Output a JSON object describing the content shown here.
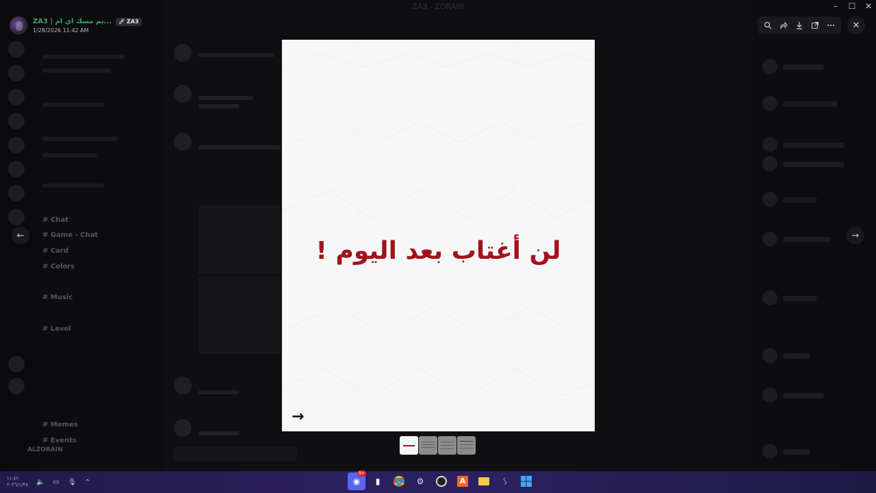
{
  "window": {
    "title": "ZA3 - ZORAIN"
  },
  "background": {
    "channels": [
      "Chat",
      "Game - Chat",
      "Card",
      "Colors",
      "Music",
      "Level",
      "Memes",
      "Events"
    ],
    "footer_user": "ALZORAIN"
  },
  "viewer": {
    "author": {
      "name": "ZA3 | يم مسك اي ام...",
      "tag": "ZA3",
      "tag_icon": "🚀",
      "timestamp": "1/28/2026 11:42 AM"
    },
    "toolbar": {
      "zoom_icon": "zoom-icon",
      "forward_icon": "forward-icon",
      "download_icon": "download-icon",
      "open_icon": "open-external-icon",
      "more_icon": "more-icon"
    },
    "close_icon": "close-icon",
    "prev_icon": "arrow-left-icon",
    "next_icon": "arrow-right-icon",
    "image": {
      "text": "لن أغتاب بعد اليوم !",
      "arrow": "→",
      "text_color": "#a3111d"
    },
    "thumbnails": {
      "count": 4,
      "active_index": 0
    }
  },
  "taskbar": {
    "clock": "١١:٤٢\n٢٠٢٦/١/٢٨",
    "apps": [
      "discord",
      "files",
      "chrome",
      "steam",
      "obs",
      "app-a",
      "explorer",
      "app-s",
      "windows"
    ],
    "discord_badge": "9+"
  }
}
